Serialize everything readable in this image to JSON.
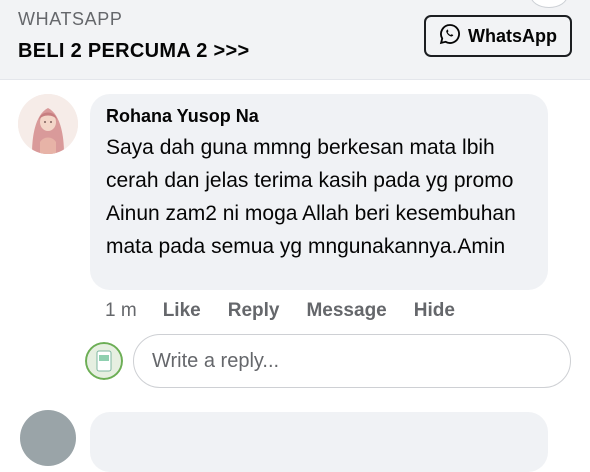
{
  "ad": {
    "source": "WHATSAPP",
    "headline": "BELI 2 PERCUMA 2 >>>",
    "cta_label": "WhatsApp"
  },
  "comment": {
    "author": "Rohana Yusop Na",
    "text": "Saya dah guna mmng berkesan mata lbih cerah dan jelas terima kasih pada yg promo Ainun zam2 ni moga Allah beri kesembuhan mata pada semua yg mngunakannya.Amin",
    "time": "1 m",
    "actions": [
      "Like",
      "Reply",
      "Message",
      "Hide"
    ]
  },
  "reply_box": {
    "placeholder": "Write a reply..."
  },
  "icons": {
    "cta": "whatsapp-icon"
  }
}
